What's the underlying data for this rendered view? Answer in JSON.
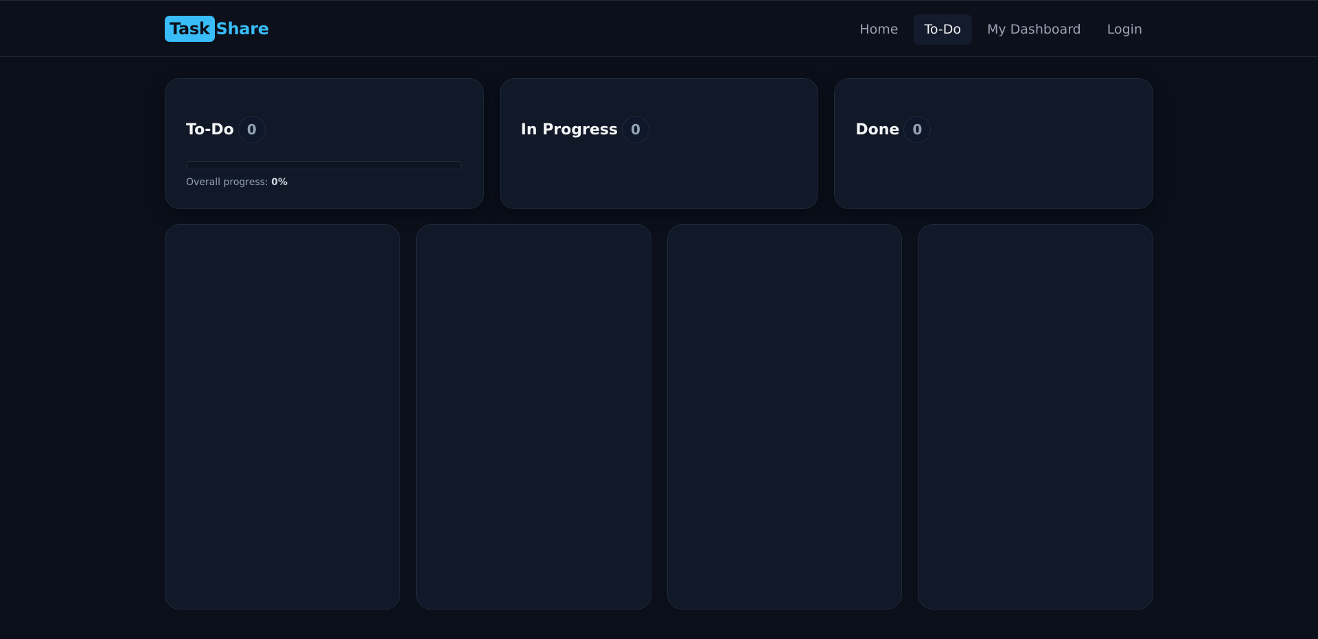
{
  "brand": {
    "part1": "Task",
    "part2": "Share",
    "accent": "#38bdf8"
  },
  "nav": [
    {
      "label": "Home",
      "active": false
    },
    {
      "label": "To-Do",
      "active": true
    },
    {
      "label": "My Dashboard",
      "active": false
    },
    {
      "label": "Login",
      "active": false
    }
  ],
  "stats": {
    "todo": {
      "title": "To-Do",
      "count": "0"
    },
    "in_progress": {
      "title": "In Progress",
      "count": "0"
    },
    "done": {
      "title": "Done",
      "count": "0"
    }
  },
  "progress": {
    "label": "Overall progress:",
    "value_text": "0%",
    "value": 0
  },
  "columns": [
    {},
    {},
    {},
    {}
  ]
}
